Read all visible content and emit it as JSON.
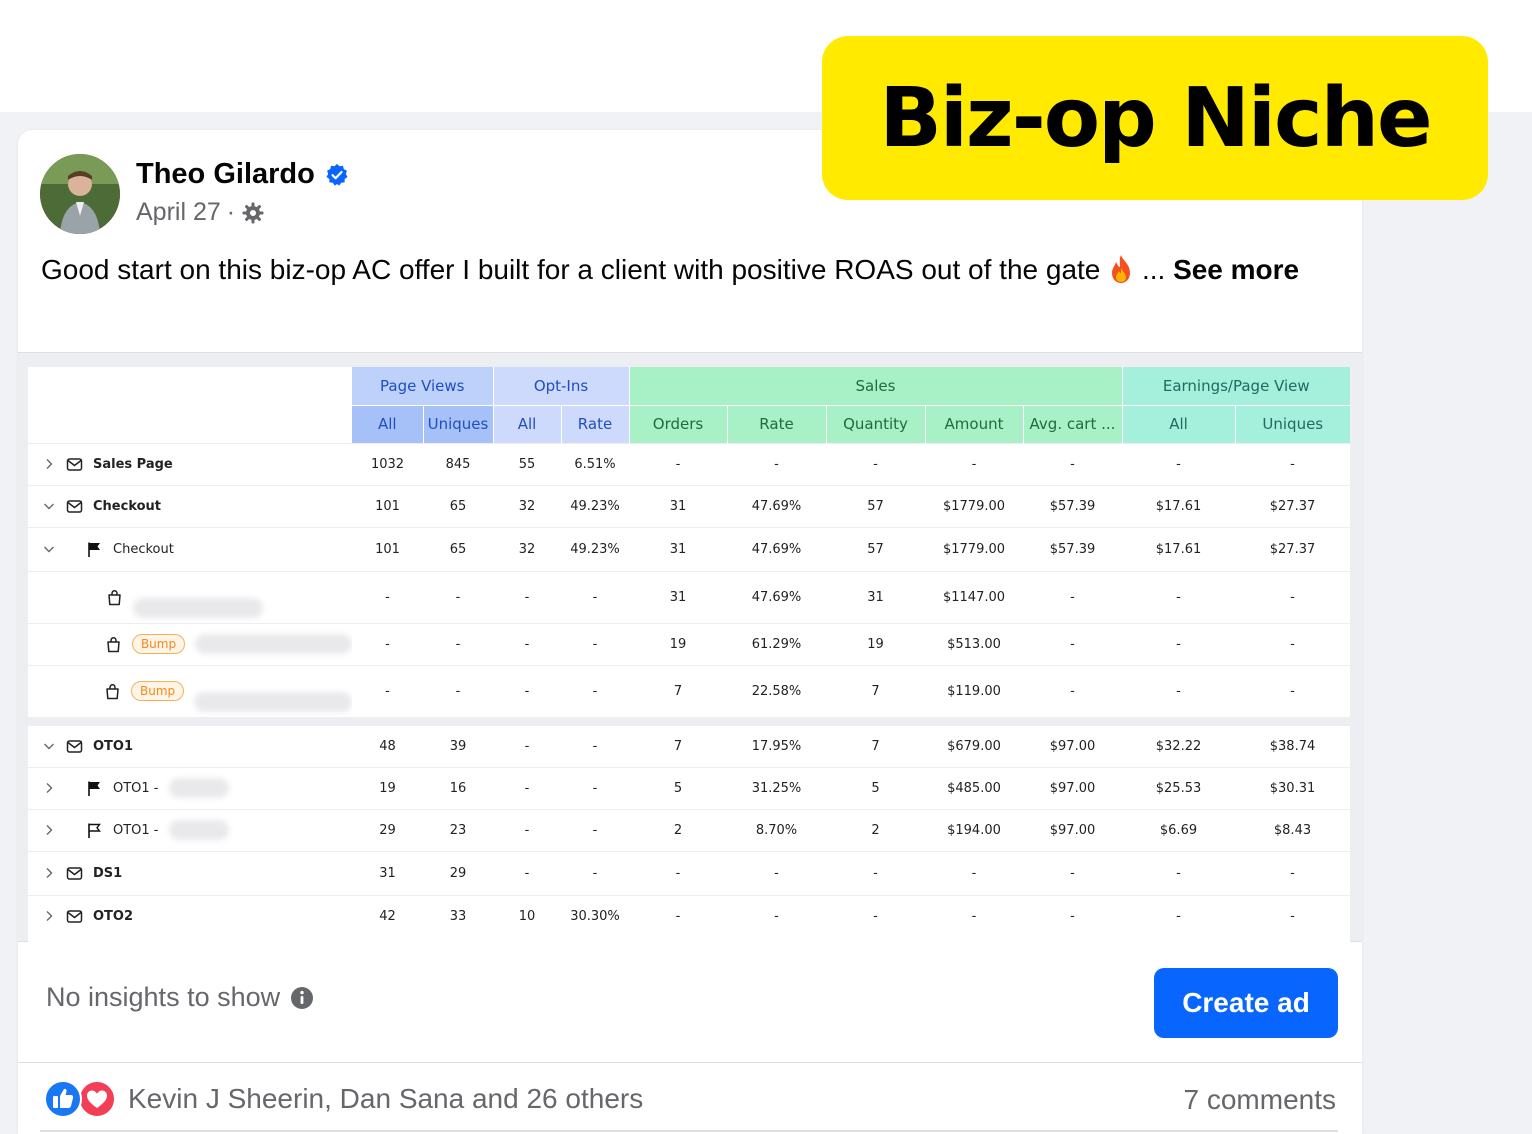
{
  "badge": {
    "text": "Biz-op Niche"
  },
  "post": {
    "author": "Theo Gilardo",
    "date": "April 27",
    "date_sep": "·",
    "text": "Good start on this biz-op AC offer I built for a client with positive ROAS out of the gate",
    "ellipsis": "...",
    "see_more": "See more"
  },
  "report": {
    "groups": [
      {
        "label": "Page Views"
      },
      {
        "label": "Opt-Ins"
      },
      {
        "label": "Sales"
      },
      {
        "label": "Earnings/Page View"
      }
    ],
    "subheaders": [
      "All",
      "Uniques",
      "All",
      "Rate",
      "Orders",
      "Rate",
      "Quantity",
      "Amount",
      "Avg. cart ...",
      "All",
      "Uniques"
    ],
    "rows": [
      {
        "label": "Sales Page",
        "values": [
          "1032",
          "845",
          "55",
          "6.51%",
          "-",
          "-",
          "-",
          "-",
          "-",
          "-",
          "-"
        ]
      },
      {
        "label": "Checkout",
        "values": [
          "101",
          "65",
          "32",
          "49.23%",
          "31",
          "47.69%",
          "57",
          "$1779.00",
          "$57.39",
          "$17.61",
          "$27.37"
        ]
      },
      {
        "label": "Checkout",
        "values": [
          "101",
          "65",
          "32",
          "49.23%",
          "31",
          "47.69%",
          "57",
          "$1779.00",
          "$57.39",
          "$17.61",
          "$27.37"
        ]
      },
      {
        "label": "",
        "values": [
          "-",
          "-",
          "-",
          "-",
          "31",
          "47.69%",
          "31",
          "$1147.00",
          "-",
          "-",
          "-"
        ]
      },
      {
        "label": "",
        "tag": "Bump",
        "values": [
          "-",
          "-",
          "-",
          "-",
          "19",
          "61.29%",
          "19",
          "$513.00",
          "-",
          "-",
          "-"
        ]
      },
      {
        "label": "",
        "tag": "Bump",
        "values": [
          "-",
          "-",
          "-",
          "-",
          "7",
          "22.58%",
          "7",
          "$119.00",
          "-",
          "-",
          "-"
        ]
      },
      {
        "label": "OTO1",
        "values": [
          "48",
          "39",
          "-",
          "-",
          "7",
          "17.95%",
          "7",
          "$679.00",
          "$97.00",
          "$32.22",
          "$38.74"
        ]
      },
      {
        "label": "OTO1 -",
        "values": [
          "19",
          "16",
          "-",
          "-",
          "5",
          "31.25%",
          "5",
          "$485.00",
          "$97.00",
          "$25.53",
          "$30.31"
        ]
      },
      {
        "label": "OTO1 -",
        "values": [
          "29",
          "23",
          "-",
          "-",
          "2",
          "8.70%",
          "2",
          "$194.00",
          "$97.00",
          "$6.69",
          "$8.43"
        ]
      },
      {
        "label": "DS1",
        "values": [
          "31",
          "29",
          "-",
          "-",
          "-",
          "-",
          "-",
          "-",
          "-",
          "-",
          "-"
        ]
      },
      {
        "label": "OTO2",
        "values": [
          "42",
          "33",
          "10",
          "30.30%",
          "-",
          "-",
          "-",
          "-",
          "-",
          "-",
          "-"
        ]
      }
    ]
  },
  "footer": {
    "insights": "No insights to show",
    "create_ad": "Create ad",
    "reactions": "Kevin J Sheerin, Dan Sana and 26 others",
    "comments": "7 comments"
  },
  "icons": {
    "verified": "verified-badge-icon",
    "settings": "gear-icon",
    "info": "info-icon",
    "like": "like-icon",
    "love": "love-icon"
  },
  "colors": {
    "accent": "#0866ff",
    "badge_bg": "#ffea00",
    "page_views_header": "#bed1fb",
    "sales_header": "#a8f0c5",
    "earnings_header": "#a4f0dc"
  }
}
